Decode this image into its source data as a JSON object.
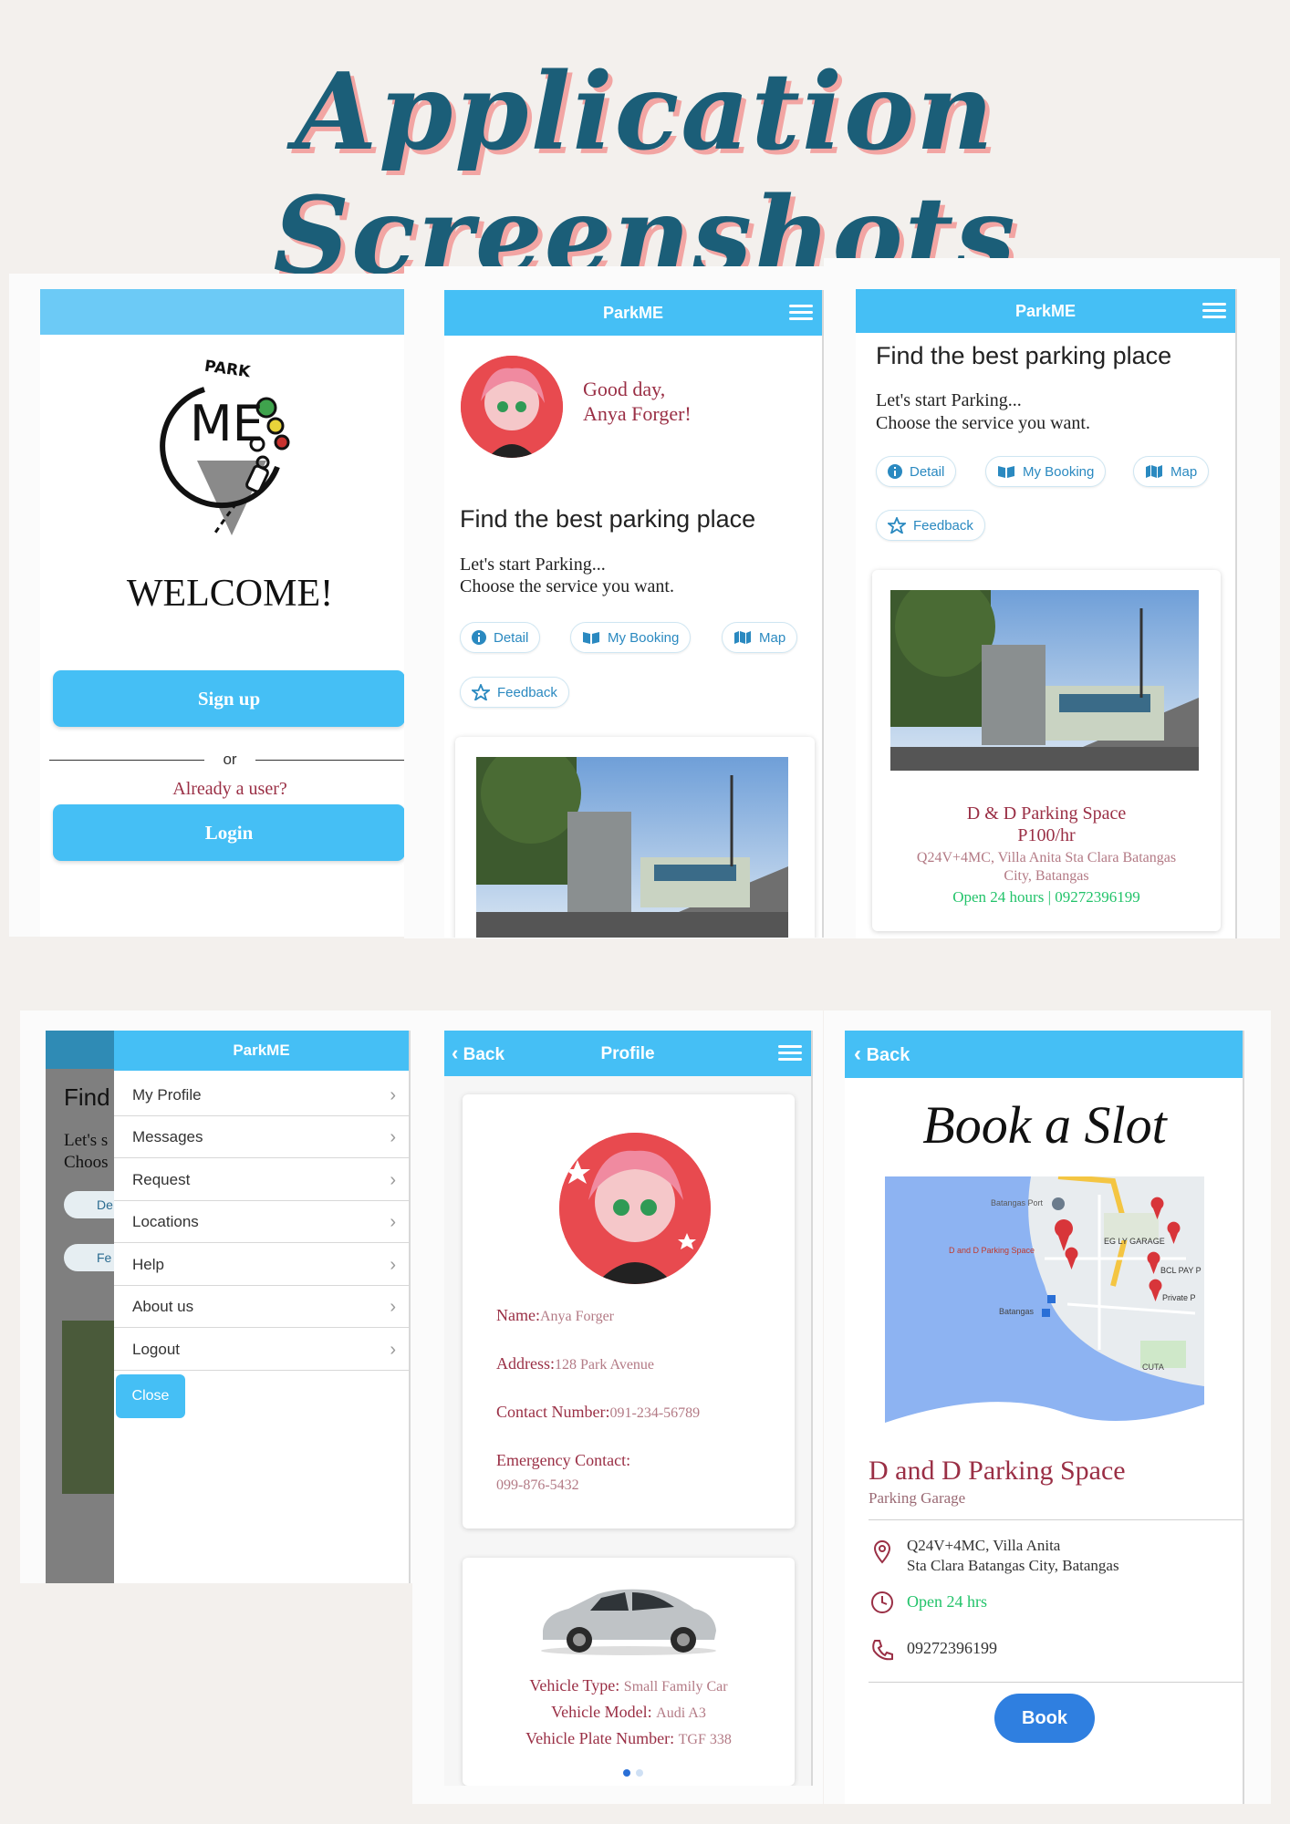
{
  "page_title": "Application Screenshots",
  "app_name": "ParkME",
  "colors": {
    "accent": "#45bff5",
    "title": "#1b5e78",
    "title_shadow": "#f2a5a3",
    "maroon": "#9a2f45",
    "green": "#22c36a"
  },
  "welcome": {
    "logo_park": "PARK",
    "logo_me": "ME",
    "heading": "WELCOME!",
    "signup_label": "Sign up",
    "or_label": "or",
    "already_user": "Already a user?",
    "login_label": "Login"
  },
  "home": {
    "greeting_line1": "Good day,",
    "greeting_line2": "Anya Forger!",
    "heading": "Find the best parking place",
    "subtitle_line1": "Let's start Parking...",
    "subtitle_line2": "Choose the service you want.",
    "chips": {
      "detail": "Detail",
      "booking": "My Booking",
      "map": "Map",
      "feedback": "Feedback"
    }
  },
  "listing": {
    "heading": "Find the best parking place",
    "subtitle_line1": "Let's start Parking...",
    "subtitle_line2": "Choose the service you want.",
    "place_name": "D & D Parking Space",
    "price": "P100/hr",
    "address_line1": "Q24V+4MC, Villa Anita Sta Clara Batangas",
    "address_line2": "City, Batangas",
    "hours_phone": "Open 24 hours | 09272396199"
  },
  "menu": {
    "bg_find": "Find",
    "bg_lets": "Let's s",
    "bg_choose": "Choos",
    "bg_chip1": "De",
    "bg_chip2": "Fe",
    "items": [
      "My Profile",
      "Messages",
      "Request",
      "Locations",
      "Help",
      "About us",
      "Logout"
    ],
    "close_label": "Close"
  },
  "profile": {
    "back_label": "Back",
    "title": "Profile",
    "name_label": "Name:",
    "name_value": "Anya Forger",
    "address_label": "Address:",
    "address_value": "128 Park Avenue",
    "contact_label": "Contact Number:",
    "contact_value": "091-234-56789",
    "emergency_label": "Emergency Contact:",
    "emergency_value": "099-876-5432",
    "vehicle_type_label": "Vehicle Type:",
    "vehicle_type_value": "Small Family Car",
    "vehicle_model_label": "Vehicle Model:",
    "vehicle_model_value": "Audi A3",
    "plate_label": "Vehicle Plate Number:",
    "plate_value": "TGF 338"
  },
  "booking": {
    "back_label": "Back",
    "heading": "Book a Slot",
    "map_labels": {
      "eg": "EG LY GARAGE",
      "dd": "D and D Parking Space",
      "bcl": "BCL PAY P",
      "private": "Private P",
      "cuta": "CUTA",
      "port": "Batangas Port",
      "batangas": "Batangas"
    },
    "place_name": "D and D Parking Space",
    "place_type": "Parking Garage",
    "address_line1": "Q24V+4MC, Villa Anita",
    "address_line2": "Sta Clara Batangas City, Batangas",
    "hours": "Open 24 hrs",
    "phone": "09272396199",
    "book_label": "Book"
  }
}
